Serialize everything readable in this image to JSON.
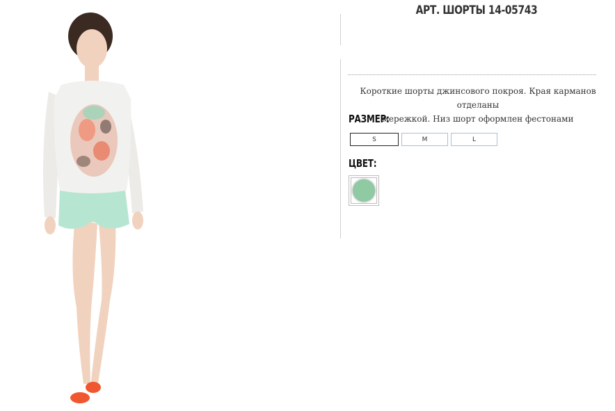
{
  "product": {
    "title": "АРТ. ШОРТЫ 14-05743",
    "description_line1": "Короткие шорты джинсового покроя. Края карманов отделаны",
    "description_line2": "мережкой. Низ шорт оформлен фестонами"
  },
  "size_section": {
    "label": "РАЗМЕР:",
    "options": [
      "S",
      "M",
      "L"
    ],
    "selected": "S"
  },
  "color_section": {
    "label": "ЦВЕТ:",
    "swatches": [
      {
        "color": "#8fcaa3",
        "selected": true
      }
    ]
  },
  "image": {
    "subject": "model wearing white printed top and mint shorts",
    "colors": {
      "top": "#f1f1ef",
      "shorts": "#b6e6d2",
      "shoes": "#f0562f",
      "skin": "#f1d2be",
      "hair": "#3a2a22"
    }
  }
}
